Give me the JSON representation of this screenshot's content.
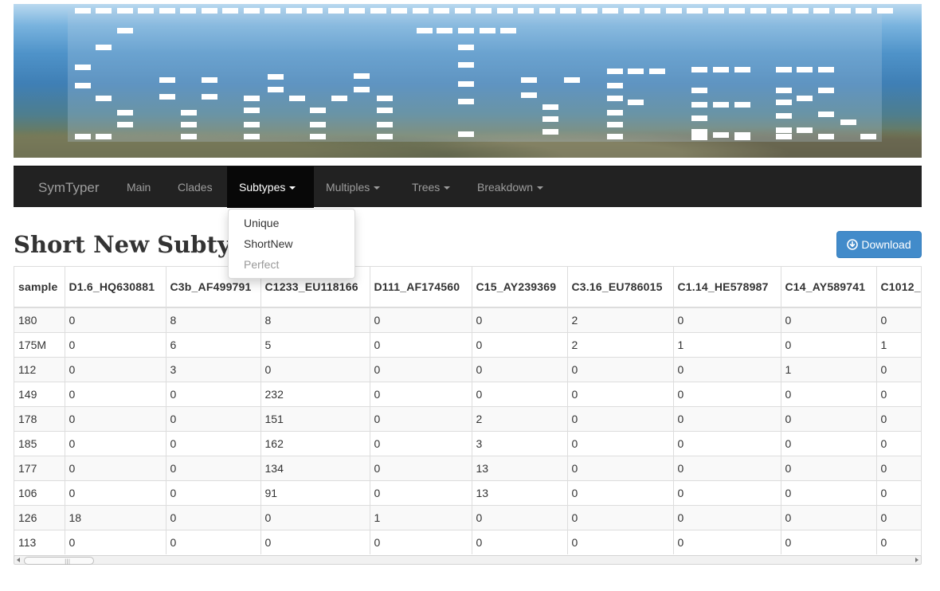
{
  "navbar": {
    "brand": "SymTyper",
    "items": [
      {
        "label": "Main",
        "dropdown": false,
        "active": false
      },
      {
        "label": "Clades",
        "dropdown": false,
        "active": false
      },
      {
        "label": "Subtypes",
        "dropdown": true,
        "active": true
      },
      {
        "label": "Multiples",
        "dropdown": true,
        "active": false
      },
      {
        "label": "Trees",
        "dropdown": true,
        "active": false
      },
      {
        "label": "Breakdown",
        "dropdown": true,
        "active": false
      }
    ]
  },
  "dropdown": {
    "items": [
      {
        "label": "Unique",
        "disabled": false
      },
      {
        "label": "ShortNew",
        "disabled": false
      },
      {
        "label": "Perfect",
        "disabled": true
      }
    ]
  },
  "page": {
    "title": "Short New Subtypes",
    "download_label": "Download"
  },
  "table": {
    "headers": [
      "sample",
      "D1.6_HQ630881",
      "C3b_AF499791",
      "C1233_EU118166",
      "D111_AF174560",
      "C15_AY239369",
      "C3.16_EU786015",
      "C1.14_HE578987",
      "C14_AY589741",
      "C1012_"
    ],
    "rows": [
      [
        "180",
        "0",
        "8",
        "8",
        "0",
        "0",
        "2",
        "0",
        "0",
        "0"
      ],
      [
        "175M",
        "0",
        "6",
        "5",
        "0",
        "0",
        "2",
        "1",
        "0",
        "1"
      ],
      [
        "112",
        "0",
        "3",
        "0",
        "0",
        "0",
        "0",
        "0",
        "1",
        "0"
      ],
      [
        "149",
        "0",
        "0",
        "232",
        "0",
        "0",
        "0",
        "0",
        "0",
        "0"
      ],
      [
        "178",
        "0",
        "0",
        "151",
        "0",
        "2",
        "0",
        "0",
        "0",
        "0"
      ],
      [
        "185",
        "0",
        "0",
        "162",
        "0",
        "3",
        "0",
        "0",
        "0",
        "0"
      ],
      [
        "177",
        "0",
        "0",
        "134",
        "0",
        "13",
        "0",
        "0",
        "0",
        "0"
      ],
      [
        "106",
        "0",
        "0",
        "91",
        "0",
        "13",
        "0",
        "0",
        "0",
        "0"
      ],
      [
        "126",
        "18",
        "0",
        "0",
        "1",
        "0",
        "0",
        "0",
        "0",
        "0"
      ],
      [
        "113",
        "0",
        "0",
        "0",
        "0",
        "0",
        "0",
        "0",
        "0",
        "0"
      ]
    ]
  },
  "colors": {
    "navbar_bg": "#222222",
    "nav_active_bg": "#080808",
    "button_primary": "#428bca",
    "banner_marks": "#ffffff"
  },
  "icons": {
    "download": "circle-arrow-down-icon",
    "caret": "caret-down-icon"
  }
}
